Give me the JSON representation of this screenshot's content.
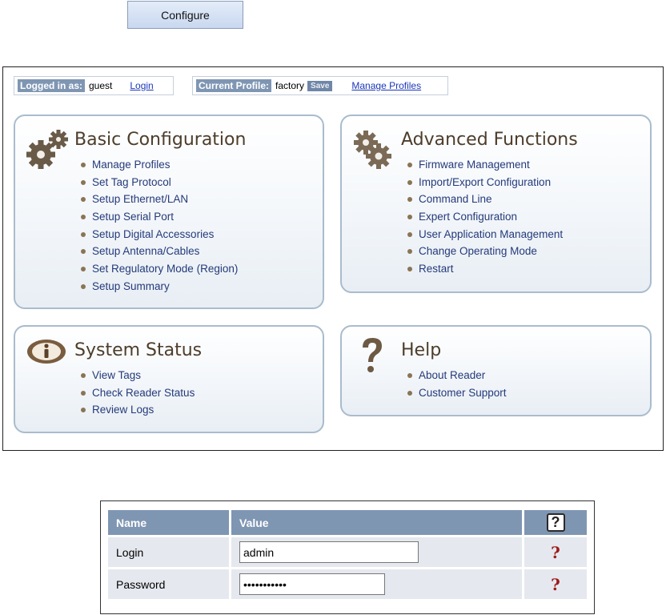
{
  "configure_button": {
    "label": "Configure"
  },
  "status_bar": {
    "logged_in_label": "Logged in as:",
    "user": "guest",
    "login_link": "Login",
    "profile_label": "Current Profile:",
    "profile": "factory",
    "save_label": "Save",
    "manage_profiles_link": "Manage Profiles"
  },
  "sections": {
    "basic": {
      "title": "Basic Configuration",
      "icon": "gears-icon",
      "items": [
        "Manage Profiles",
        "Set Tag Protocol",
        "Setup Ethernet/LAN",
        "Setup Serial Port",
        "Setup Digital Accessories",
        "Setup Antenna/Cables",
        "Set Regulatory Mode (Region)",
        "Setup Summary"
      ]
    },
    "advanced": {
      "title": "Advanced Functions",
      "icon": "advanced-gears-icon",
      "items": [
        "Firmware Management",
        "Import/Export Configuration",
        "Command Line",
        "Expert Configuration",
        "User Application Management",
        "Change Operating Mode",
        "Restart"
      ]
    },
    "status": {
      "title": "System Status",
      "icon": "info-icon",
      "items": [
        "View Tags",
        "Check Reader Status",
        "Review Logs"
      ]
    },
    "help": {
      "title": "Help",
      "icon": "question-mark-icon",
      "items": [
        "About Reader",
        "Customer Support"
      ]
    }
  },
  "login_form": {
    "headers": {
      "name": "Name",
      "value": "Value",
      "help": "?"
    },
    "rows": [
      {
        "label": "Login",
        "value": "admin",
        "type": "text",
        "help": "?"
      },
      {
        "label": "Password",
        "value": "•••••••••••",
        "type": "password",
        "help": "?"
      }
    ]
  },
  "colors": {
    "header_bg": "#7f96b3",
    "card_border": "#a9bccd",
    "link": "#1c37b8",
    "item_text": "#243a7a",
    "title_text": "#4d3d2b",
    "help_red": "#9b1b1b"
  }
}
